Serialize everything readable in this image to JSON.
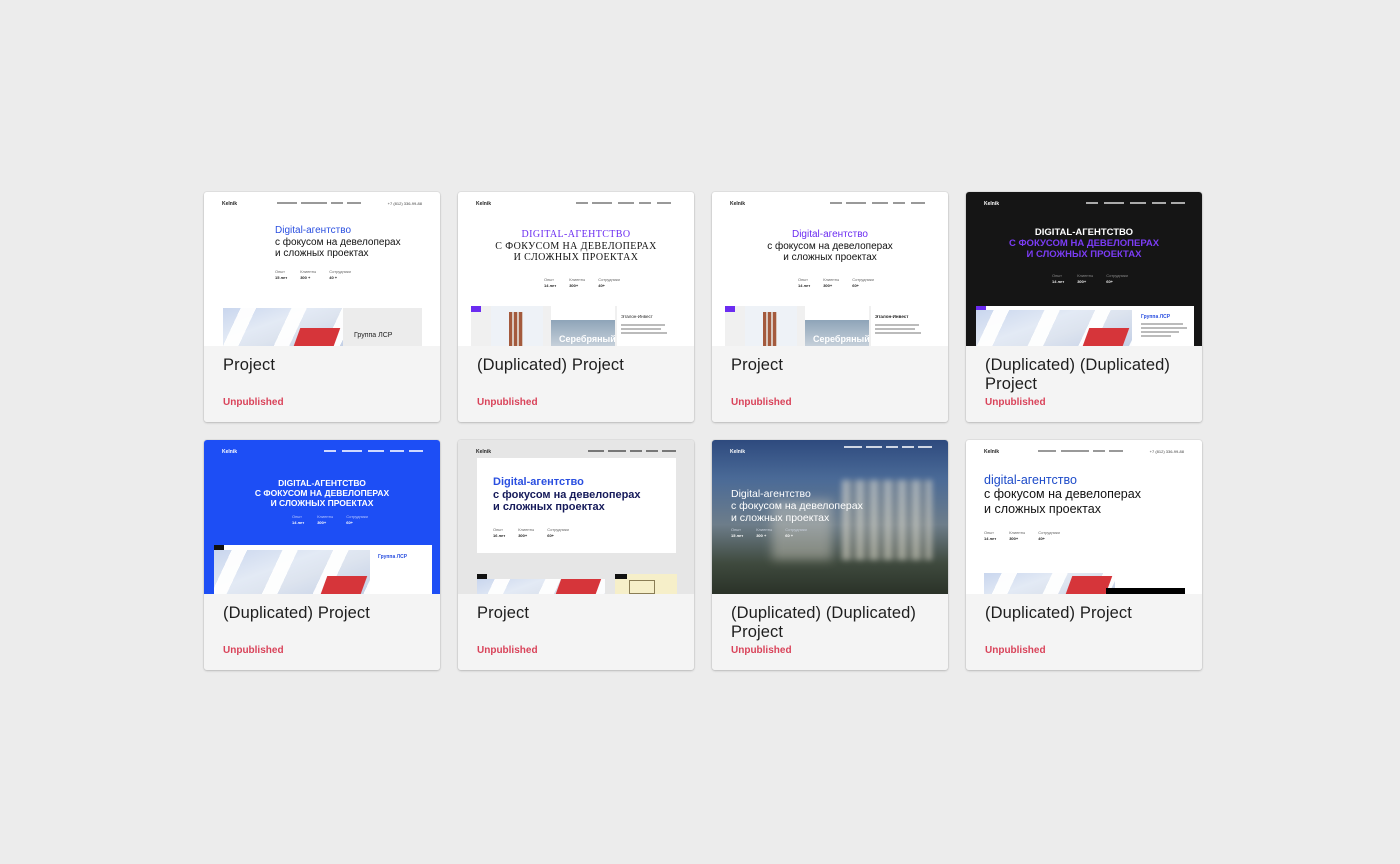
{
  "cards": [
    {
      "title": "Project",
      "status": "Unpublished",
      "thumb": {
        "logo": "Kelnik",
        "phone": "+7 (812) 336-99-88",
        "hero": [
          "Digital-агентство",
          "с фокусом на девелоперах",
          "и сложных проектах"
        ],
        "stats": [
          [
            "Опыт",
            "15 лет"
          ],
          [
            "Клиенты",
            "300 +"
          ],
          [
            "Сотрудники",
            "40 +"
          ]
        ],
        "caption": "Группа ЛСР"
      }
    },
    {
      "title": "(Duplicated) Project",
      "status": "Unpublished",
      "thumb": {
        "logo": "Kelnik",
        "hero": [
          "DIGITAL-АГЕНТСТВО",
          "С ФОКУСОМ НА ДЕВЕЛОПЕРАХ",
          "И СЛОЖНЫХ ПРОЕКТАХ"
        ],
        "stats": [
          [
            "Опыт",
            "14 лет"
          ],
          [
            "Клиенты",
            "300+"
          ],
          [
            "Сотрудники",
            "40+"
          ]
        ],
        "caption": "Эталон-Инвест",
        "caption2": "Серебряный"
      }
    },
    {
      "title": "Project",
      "status": "Unpublished",
      "thumb": {
        "logo": "Kelnik",
        "hero": [
          "Digital-агентство",
          "с фокусом на девелоперах",
          "и сложных проектах"
        ],
        "stats": [
          [
            "Опыт",
            "14 лет"
          ],
          [
            "Клиенты",
            "300+"
          ],
          [
            "Сотрудники",
            "60+"
          ]
        ],
        "caption": "Эталон-Инвест",
        "caption2": "Серебряный"
      }
    },
    {
      "title": "(Duplicated) (Duplicated) Project",
      "status": "Unpublished",
      "thumb": {
        "logo": "Kelnik",
        "hero": [
          "DIGITAL-АГЕНТСТВО",
          "С ФОКУСОМ НА ДЕВЕЛОПЕРАХ",
          "И СЛОЖНЫХ ПРОЕКТАХ"
        ],
        "stats": [
          [
            "Опыт",
            "14 лет"
          ],
          [
            "Клиенты",
            "300+"
          ],
          [
            "Сотрудники",
            "60+"
          ]
        ],
        "caption": "Группа ЛСР"
      }
    },
    {
      "title": "(Duplicated) Project",
      "status": "Unpublished",
      "thumb": {
        "logo": "Kelnik",
        "hero": [
          "DIGITAL-АГЕНТСТВО",
          "С ФОКУСОМ НА ДЕВЕЛОПЕРАХ",
          "И СЛОЖНЫХ ПРОЕКТАХ"
        ],
        "stats": [
          [
            "Опыт",
            "14 лет"
          ],
          [
            "Клиенты",
            "300+"
          ],
          [
            "Сотрудники",
            "60+"
          ]
        ],
        "caption": "Группа ЛСР"
      }
    },
    {
      "title": "Project",
      "status": "Unpublished",
      "thumb": {
        "logo": "Kelnik",
        "hero": [
          "Digital-агентство",
          "с фокусом на девелоперах",
          "и сложных проектах"
        ],
        "stats": [
          [
            "Опыт",
            "16 лет"
          ],
          [
            "Клиенты",
            "300+"
          ],
          [
            "Сотрудники",
            "60+"
          ]
        ]
      }
    },
    {
      "title": "(Duplicated) (Duplicated) Project",
      "status": "Unpublished",
      "thumb": {
        "logo": "Kelnik",
        "hero": [
          "Digital-агентство",
          "с фокусом на девелоперах",
          "и сложных проектах"
        ],
        "stats": [
          [
            "Опыт",
            "15 лет"
          ],
          [
            "Клиенты",
            "300 +"
          ],
          [
            "Сотрудники",
            "60 +"
          ]
        ]
      }
    },
    {
      "title": "(Duplicated) Project",
      "status": "Unpublished",
      "thumb": {
        "logo": "Kelnik",
        "phone": "+7 (812) 336-99-88",
        "hero": [
          "digital-агентство",
          "с фокусом на девелоперах",
          "и сложных проектах"
        ],
        "stats": [
          [
            "Опыт",
            "14 лет"
          ],
          [
            "Клиенты",
            "300+"
          ],
          [
            "Сотрудники",
            "40+"
          ]
        ]
      }
    }
  ],
  "colors": {
    "status": "#d9435a",
    "blue": "#2a4fe0",
    "violet": "#6b2cf1",
    "dark": "#151515",
    "brand_blue": "#1d4ef5"
  }
}
